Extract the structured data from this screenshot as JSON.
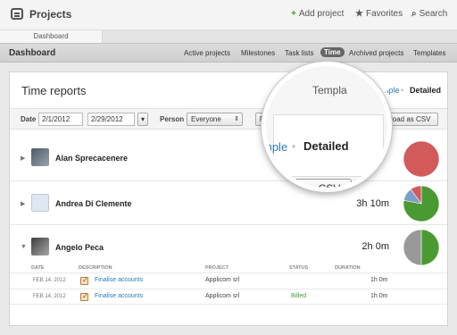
{
  "app": {
    "title": "Projects"
  },
  "top_actions": {
    "add_project": "Add project",
    "favorites": "Favorites",
    "search": "Search"
  },
  "tabs": [
    {
      "label": "Dashboard"
    }
  ],
  "nav": {
    "title": "Dashboard",
    "links": [
      "Active projects",
      "Milestones",
      "Task lists",
      "Time",
      "Archived projects",
      "Templates"
    ],
    "active": "Time"
  },
  "time_reports": {
    "title": "Time reports",
    "view_simple": "Simple",
    "view_separator": "•",
    "view_detailed": "Detailed",
    "filter": {
      "date_label": "Date",
      "date_from": "2/1/2012",
      "date_to": "2/29/2012",
      "person_label": "Person",
      "person_value": "Everyone",
      "run_label": "Ru",
      "download_label": "nload as CSV"
    },
    "people": [
      {
        "name": "Alan Sprecacenere",
        "total": ""
      },
      {
        "name": "Andrea Di Clemente",
        "total": "3h 10m"
      },
      {
        "name": "Angelo Peca",
        "total": "2h 0m"
      }
    ],
    "columns": {
      "date": "DATE",
      "description": "DESCRIPTION",
      "project": "PROJECT",
      "status": "STATUS",
      "duration": "DURATION"
    },
    "entries": [
      {
        "date": "FEB 14, 2012",
        "description": "Finalise accounts",
        "project": "Applicom srl",
        "status": "",
        "duration": "1h 0m"
      },
      {
        "date": "FEB 14, 2012",
        "description": "Finalise accounts",
        "project": "Applicom srl",
        "status": "Billed",
        "duration": "1h 0m"
      }
    ]
  },
  "magnifier": {
    "header_fragment": "Templa",
    "simple_fragment": "mple",
    "separator": "•",
    "detailed": "Detailed",
    "download": "load as CSV"
  },
  "pies": [
    {
      "slices": [
        {
          "value": 1.0,
          "color": "#d35a5a"
        }
      ]
    },
    {
      "slices": [
        {
          "value": 0.78,
          "color": "#4a9a33"
        },
        {
          "value": 0.12,
          "color": "#7b9fc9"
        },
        {
          "value": 0.1,
          "color": "#d35a5a"
        }
      ]
    },
    {
      "slices": [
        {
          "value": 0.5,
          "color": "#4a9a33"
        },
        {
          "value": 0.5,
          "color": "#999999"
        }
      ]
    }
  ],
  "colors": {
    "link": "#2a7ab8",
    "green": "#4a9a33",
    "billed": "#4a9a33"
  }
}
